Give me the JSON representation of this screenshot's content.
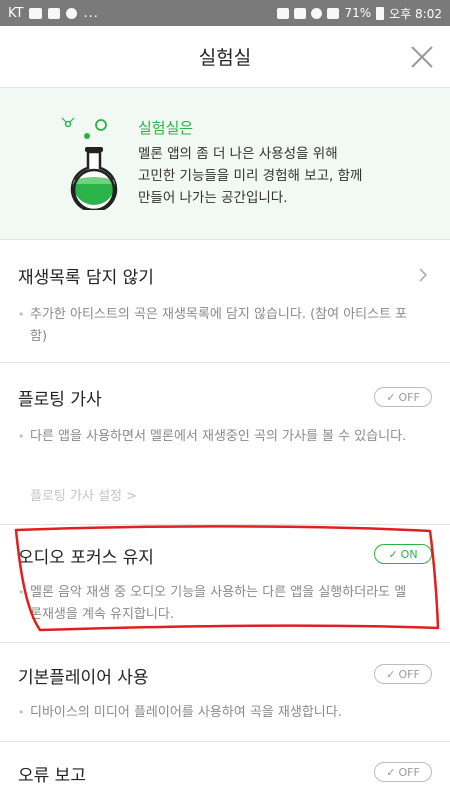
{
  "statusbar": {
    "carrier": "KT",
    "dots": "...",
    "battery": "71%",
    "time_label": "오후 8:02"
  },
  "header": {
    "title": "실험실"
  },
  "intro": {
    "title": "실험실은",
    "description": "멜론 앱의 좀 더 나은 사용성을 위해\n고민한 기능들을 미리 경험해 보고, 함께\n만들어 나가는 공간입니다."
  },
  "items": [
    {
      "title": "재생목록 담지 않기",
      "description": "추가한 아티스트의 곡은 재생목록에 담지 않습니다. (참여 아티스트 포함)",
      "control": "chevron"
    },
    {
      "title": "플로팅 가사",
      "description": "다른 앱을 사용하면서 멜론에서 재생중인 곡의 가사를 볼 수 있습니다.",
      "sub_link": "플로팅 가사 설정 >",
      "toggle": "OFF"
    },
    {
      "title": "오디오 포커스 유지",
      "description": "멜론 음악 재생 중 오디오 기능을 사용하는 다른 앱을 실행하더라도 멜론재생을 계속 유지합니다.",
      "toggle": "ON"
    },
    {
      "title": "기본플레이어 사용",
      "description": "디바이스의 미디어 플레이어를 사용하여 곡을 재생합니다.",
      "toggle": "OFF"
    },
    {
      "title": "오류 보고",
      "toggle": "OFF"
    }
  ],
  "colors": {
    "accent_green": "#2bb34a",
    "annotation_red": "#e02020"
  }
}
